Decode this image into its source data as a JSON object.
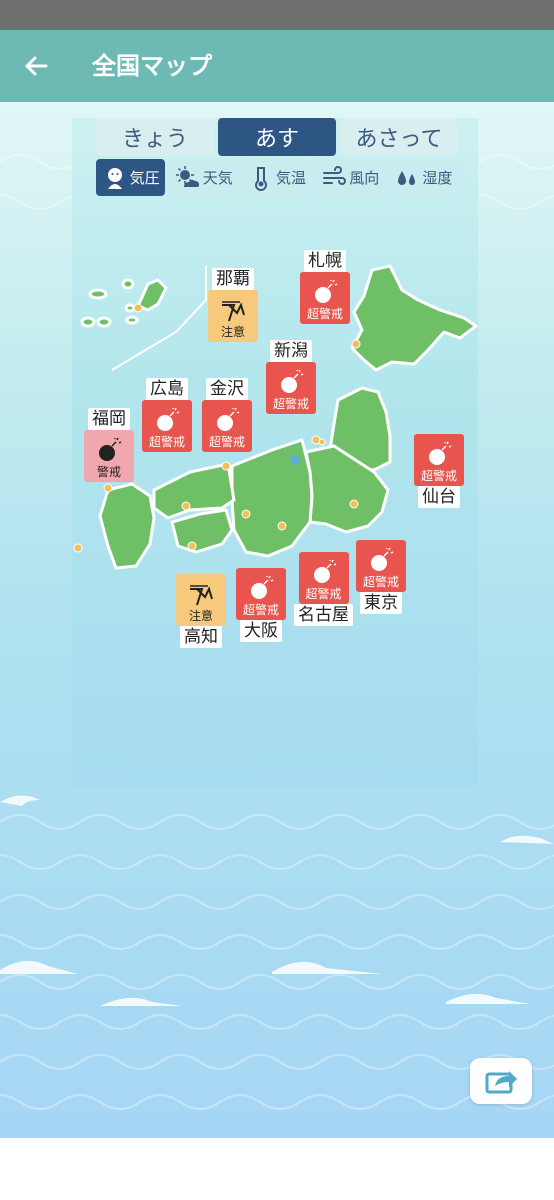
{
  "header": {
    "title": "全国マップ",
    "back_icon": "back-arrow-icon"
  },
  "day_tabs": [
    {
      "label": "きょう",
      "active": false
    },
    {
      "label": "あす",
      "active": true
    },
    {
      "label": "あさって",
      "active": false
    }
  ],
  "category_tabs": [
    {
      "label": "気圧",
      "icon": "pressure-mascot-icon",
      "active": true
    },
    {
      "label": "天気",
      "icon": "weather-icon",
      "active": false
    },
    {
      "label": "気温",
      "icon": "thermometer-icon",
      "active": false
    },
    {
      "label": "風向",
      "icon": "wind-icon",
      "active": false
    },
    {
      "label": "湿度",
      "icon": "humidity-icon",
      "active": false
    }
  ],
  "cities": [
    {
      "name": "札幌",
      "level": "超警戒",
      "icon": "bomb-icon"
    },
    {
      "name": "那覇",
      "level": "注意",
      "icon": "pressure-wave-icon"
    },
    {
      "name": "新潟",
      "level": "超警戒",
      "icon": "bomb-icon"
    },
    {
      "name": "広島",
      "level": "超警戒",
      "icon": "bomb-icon"
    },
    {
      "name": "金沢",
      "level": "超警戒",
      "icon": "bomb-icon"
    },
    {
      "name": "福岡",
      "level": "警戒",
      "icon": "bomb-icon"
    },
    {
      "name": "仙台",
      "level": "超警戒",
      "icon": "bomb-icon"
    },
    {
      "name": "東京",
      "level": "超警戒",
      "icon": "bomb-icon"
    },
    {
      "name": "名古屋",
      "level": "超警戒",
      "icon": "bomb-icon"
    },
    {
      "name": "大阪",
      "level": "超警戒",
      "icon": "bomb-icon"
    },
    {
      "name": "高知",
      "level": "注意",
      "icon": "pressure-wave-icon"
    }
  ],
  "colors": {
    "header": "#6cbab3",
    "active_tab": "#2e5684",
    "super_warning": "#e8554e",
    "warning": "#f0a7ad",
    "caution": "#f6c97d",
    "land": "#6fbf66"
  },
  "share_icon": "share-icon"
}
